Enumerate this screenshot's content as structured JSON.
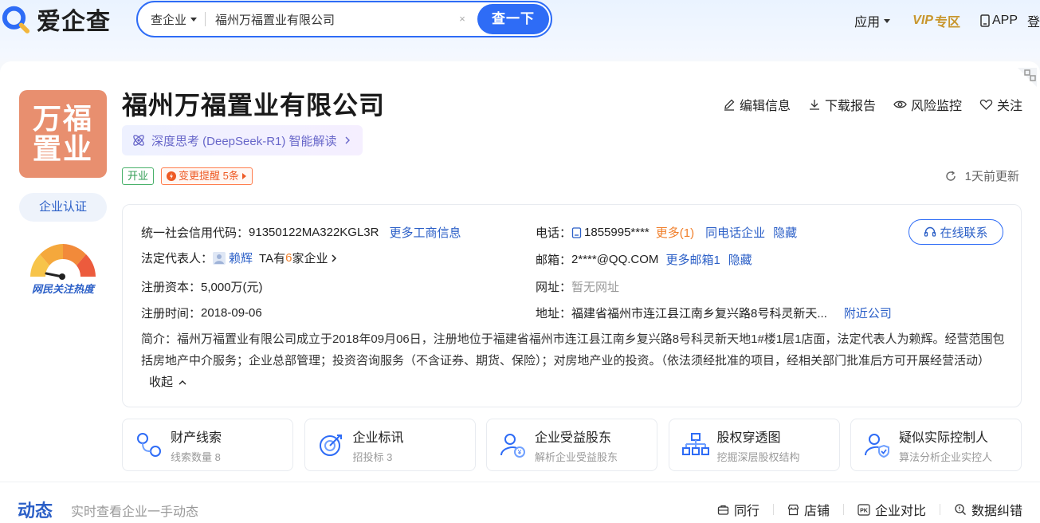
{
  "header": {
    "logo_text": "爱企查",
    "search": {
      "type_label": "查企业",
      "value": "福州万福置业有限公司",
      "clear": "×",
      "button": "查一下"
    },
    "nav": {
      "apps": "应用",
      "vip": "VIP",
      "vip_suffix": "专区",
      "app": "APP",
      "login": "登"
    }
  },
  "company": {
    "logo_line1": "万福",
    "logo_line2": "置业",
    "name": "福州万福置业有限公司",
    "ai_chip": "深度思考 (DeepSeek-R1) 智能解读",
    "tag_open": "开业",
    "tag_change": "变更提醒 5条",
    "cert": "企业认证",
    "heat_label": "网民关注热度",
    "updated": "1天前更新"
  },
  "actions": {
    "edit": "编辑信息",
    "download": "下载报告",
    "monitor": "风险监控",
    "follow": "关注"
  },
  "info": {
    "credit_label": "统一社会信用代码：",
    "credit_value": "91350122MA322KGL3R",
    "credit_more": "更多工商信息",
    "legal_label": "法定代表人：",
    "legal_name": "赖辉",
    "legal_ta_prefix": "TA有",
    "legal_ta_count": "6",
    "legal_ta_suffix": "家企业",
    "capital_label": "注册资本：",
    "capital_value": "5,000万(元)",
    "date_label": "注册时间：",
    "date_value": "2018-09-06",
    "phone_label": "电话：",
    "phone_value": "1855995****",
    "phone_more": "更多(1)",
    "phone_same": "同电话企业",
    "phone_hide": "隐藏",
    "email_label": "邮箱：",
    "email_value": "2****@QQ.COM",
    "email_more": "更多邮箱1",
    "email_hide": "隐藏",
    "web_label": "网址：",
    "web_value": "暂无网址",
    "addr_label": "地址：",
    "addr_value": "福建省福州市连江县江南乡复兴路8号科灵新天...",
    "addr_nearby": "附近公司",
    "contact": "在线联系",
    "brief_label": "简介：",
    "brief": "福州万福置业有限公司成立于2018年09月06日，注册地位于福建省福州市连江县江南乡复兴路8号科灵新天地1#楼1层1店面，法定代表人为赖辉。经营范围包括房地产中介服务；企业总部管理；投资咨询服务（不含证券、期货、保险）；对房地产业的投资。（依法须经批准的项目，经相关部门批准后方可开展经营活动）",
    "collapse": "收起"
  },
  "features": [
    {
      "title": "财产线索",
      "sub": "线索数量 8"
    },
    {
      "title": "企业标讯",
      "sub": "招投标 3"
    },
    {
      "title": "企业受益股东",
      "sub": "解析企业受益股东"
    },
    {
      "title": "股权穿透图",
      "sub": "挖掘深层股权结构"
    },
    {
      "title": "疑似实际控制人",
      "sub": "算法分析企业实控人"
    }
  ],
  "footer": {
    "title": "动态",
    "subtitle": "实时查看企业一手动态",
    "peers": "同行",
    "store": "店铺",
    "compare": "企业对比",
    "correct": "数据纠错"
  },
  "colors": {
    "brand_blue": "#2e6cf6",
    "link_blue": "#2b5fc7",
    "logo_orange": "#e88f6f",
    "vip_gold": "#c8962d",
    "accent_orange": "#f07f2b"
  }
}
